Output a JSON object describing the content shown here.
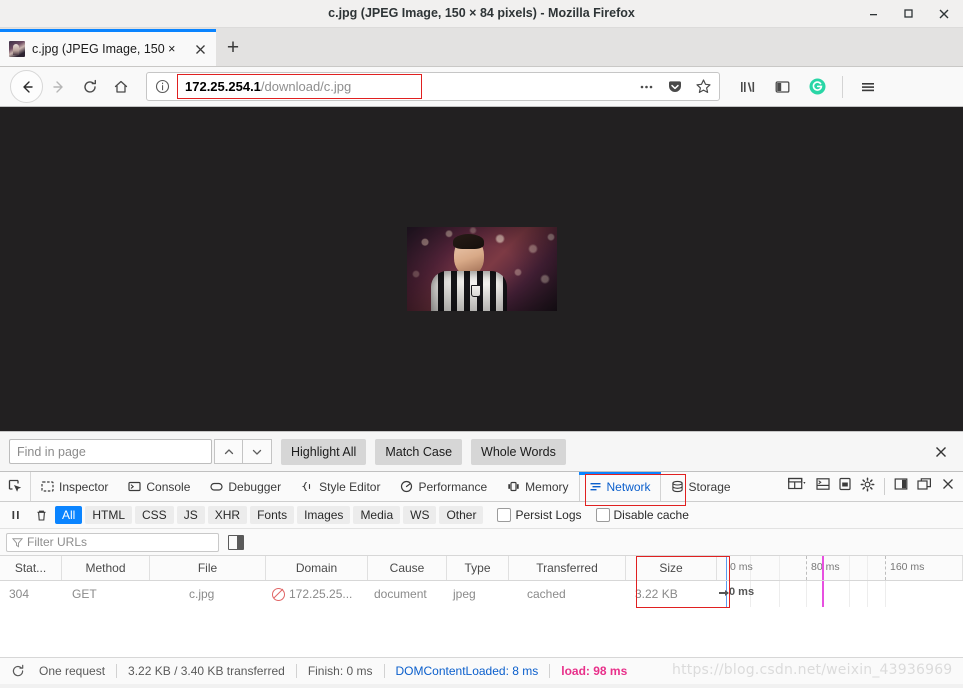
{
  "window": {
    "title": "c.jpg (JPEG Image, 150 × 84 pixels) - Mozilla Firefox",
    "minimize": "—",
    "maximize": "□",
    "close": "✕"
  },
  "tabs": {
    "items": [
      {
        "label": "c.jpg (JPEG Image, 150 ×",
        "close": "✕",
        "favicon": "image-favicon"
      }
    ],
    "new_tab": "+"
  },
  "navbar": {
    "back": "←",
    "forward": "→",
    "reload": "⟳",
    "home": "⌂",
    "url_host": "172.25.254.1",
    "url_path": "/download/c.jpg",
    "page_actions": "…",
    "pocket": "pocket-icon",
    "bookmark": "☆",
    "library": "library-icon",
    "sidebars": "sidebar-icon",
    "account": "account-icon",
    "menu": "☰"
  },
  "content": {
    "image_alt": "c.jpg",
    "image_width": "150",
    "image_height": "84",
    "background_color": "#222021"
  },
  "findbar": {
    "placeholder": "Find in page",
    "value": "",
    "prev": "⌃",
    "next": "⌄",
    "highlight_all": "Highlight All",
    "match_case": "Match Case",
    "whole_words": "Whole Words",
    "close": "✕"
  },
  "devtools": {
    "picker": "element-picker-icon",
    "tabs": [
      {
        "label": "Inspector",
        "icon": "inspector-icon",
        "active": false
      },
      {
        "label": "Console",
        "icon": "console-icon",
        "active": false
      },
      {
        "label": "Debugger",
        "icon": "debugger-icon",
        "active": false
      },
      {
        "label": "Style Editor",
        "icon": "style-editor-icon",
        "active": false
      },
      {
        "label": "Performance",
        "icon": "performance-icon",
        "active": false
      },
      {
        "label": "Memory",
        "icon": "memory-icon",
        "active": false
      },
      {
        "label": "Network",
        "icon": "network-icon",
        "active": true
      },
      {
        "label": "Storage",
        "icon": "storage-icon",
        "active": false
      }
    ],
    "tools": [
      "responsive-design-icon",
      "split-console-icon",
      "screenshot-icon",
      "settings-gear-icon",
      "dock-side-icon",
      "dock-window-icon",
      "close-devtools-icon"
    ],
    "filters": {
      "pause": "pause-icon",
      "clear": "trash-icon",
      "chips": [
        "All",
        "HTML",
        "CSS",
        "JS",
        "XHR",
        "Fonts",
        "Images",
        "Media",
        "WS",
        "Other"
      ],
      "active_chip": "All",
      "persist_logs": "Persist Logs",
      "disable_cache": "Disable cache",
      "persist_logs_checked": false,
      "disable_cache_checked": false
    },
    "url_filter": {
      "placeholder": "Filter URLs",
      "value": "",
      "sidebar_toggle": "network-sidebar-toggle-icon"
    },
    "table": {
      "columns": [
        "Stat...",
        "Method",
        "File",
        "Domain",
        "Cause",
        "Type",
        "Transferred",
        "Size"
      ],
      "rows": [
        {
          "status": "304",
          "method": "GET",
          "file": "c.jpg",
          "domain": "172.25.25...",
          "domain_icon": "blocked-cache-icon",
          "cause": "document",
          "type": "jpeg",
          "transferred": "cached",
          "size": "3.22 KB",
          "waterfall_label": "0 ms"
        }
      ],
      "timeline_ticks": [
        "0 ms",
        "80 ms",
        "160 ms"
      ]
    },
    "status": {
      "reload_icon": "reload-requests-icon",
      "requests": "One request",
      "transferred": "3.22 KB / 3.40 KB transferred",
      "finish": "Finish: 0 ms",
      "dom_content_loaded": "DOMContentLoaded: 8 ms",
      "load": "load: 98 ms",
      "watermark": "https://blog.csdn.net/weixin_43936969"
    }
  },
  "colors": {
    "accent_blue": "#0a84ff",
    "link_blue": "#0b5fcc",
    "load_pink": "#e8308a",
    "highlight_red": "#e02020",
    "content_bg": "#222021"
  }
}
